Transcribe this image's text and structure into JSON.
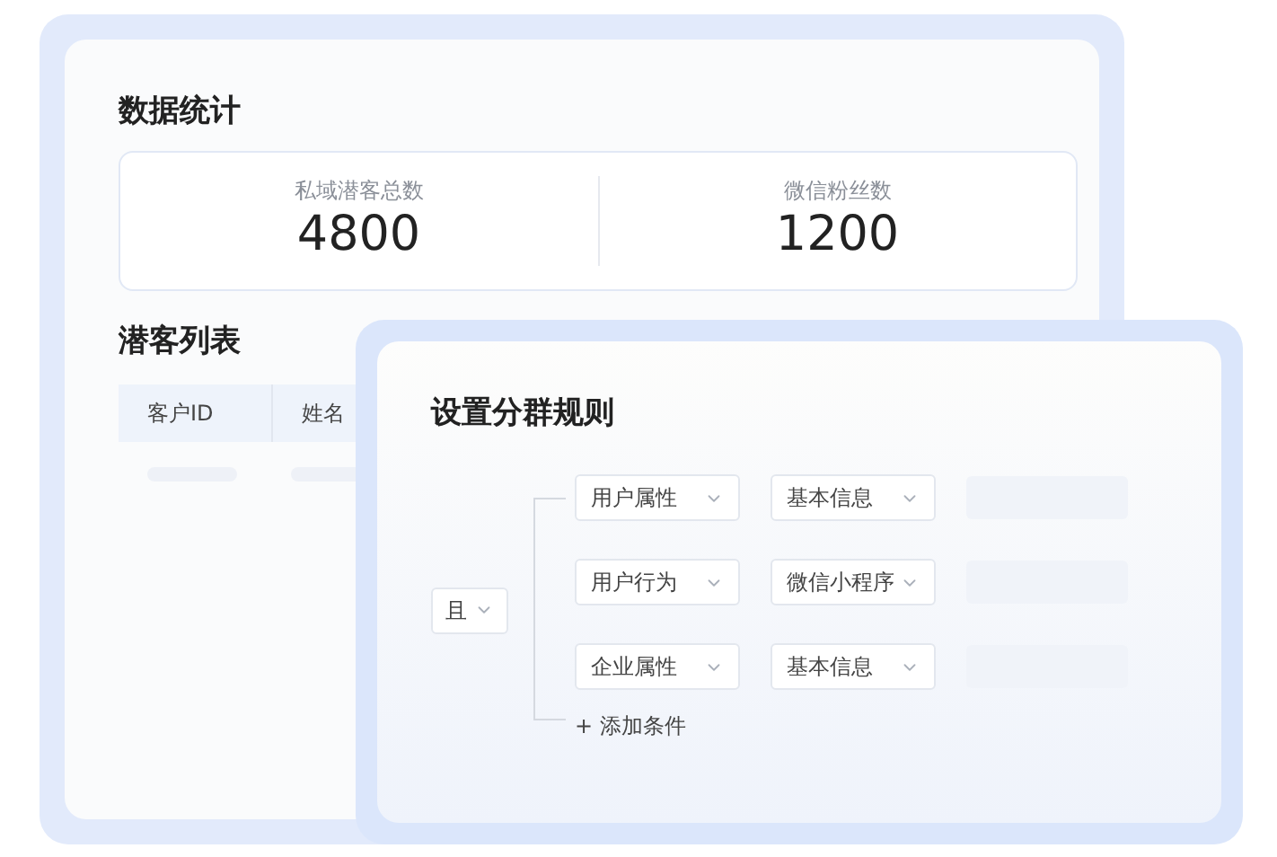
{
  "stats_section": {
    "title": "数据统计",
    "metrics": [
      {
        "label": "私域潜客总数",
        "value": "4800"
      },
      {
        "label": "微信粉丝数",
        "value": "1200"
      }
    ]
  },
  "leads_section": {
    "title": "潜客列表",
    "table": {
      "columns": [
        "客户ID",
        "姓名"
      ]
    }
  },
  "rule_dialog": {
    "title": "设置分群规则",
    "logic_operator": "且",
    "conditions": [
      {
        "category": "用户属性",
        "field": "基本信息"
      },
      {
        "category": "用户行为",
        "field": "微信小程序"
      },
      {
        "category": "企业属性",
        "field": "基本信息"
      }
    ],
    "add_button": "+ 添加条件"
  }
}
